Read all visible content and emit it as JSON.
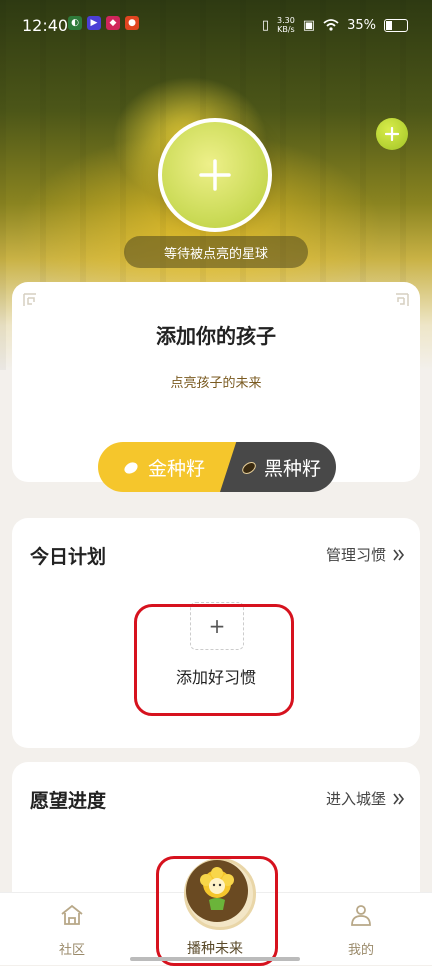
{
  "status_bar": {
    "time": "12:40",
    "net_speed_value": "3.30",
    "net_speed_unit": "KB/s",
    "battery": "35%"
  },
  "hero": {
    "planet_caption": "等待被点亮的星球"
  },
  "child_card": {
    "title": "添加你的孩子",
    "subtitle": "点亮孩子的未来",
    "gold_seed_label": "金种籽",
    "black_seed_label": "黑种籽"
  },
  "plan_card": {
    "title": "今日计划",
    "link_label": "管理习惯",
    "add_habit_label": "添加好习惯"
  },
  "wish_card": {
    "title": "愿望进度",
    "link_label": "进入城堡"
  },
  "bottom_nav": {
    "community_label": "社区",
    "sow_label": "播种未来",
    "mine_label": "我的"
  },
  "colors": {
    "gold": "#f5c62c",
    "dark": "#484848",
    "highlight_red": "#d6121e"
  }
}
